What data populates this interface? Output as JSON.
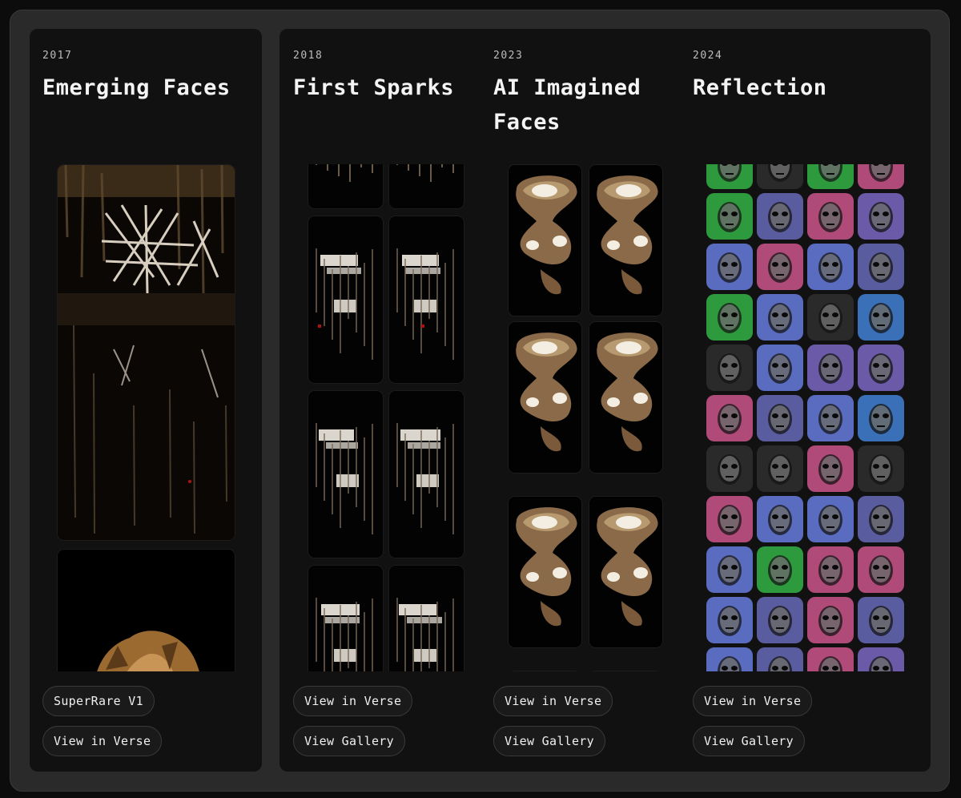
{
  "collections": [
    {
      "year": "2017",
      "title": "Emerging Faces",
      "buttons": [
        "SuperRare V1",
        "View in Verse"
      ]
    },
    {
      "year": "2018",
      "title": "First Sparks",
      "buttons": [
        "View in Verse",
        "View Gallery"
      ]
    },
    {
      "year": "2023",
      "title_lines": [
        "AI Imagined",
        "Faces"
      ],
      "buttons": [
        "View in Verse",
        "View Gallery"
      ]
    },
    {
      "year": "2024",
      "title": "Reflection",
      "buttons": [
        "View in Verse",
        "View Gallery"
      ]
    }
  ],
  "reflection_grid": {
    "columns": 4,
    "cell_colors": [
      "#2e9a3e",
      "#2a2a2a",
      "#2e9a3e",
      "#b04a78",
      "#2e9a3e",
      "#5a5ca0",
      "#b04a78",
      "#6a5aa8",
      "#5a6cc0",
      "#b04a78",
      "#5a6cc0",
      "#5a5ca0",
      "#2e9a3e",
      "#5a6cc0",
      "#2a2a2a",
      "#3a70b8",
      "#2a2a2a",
      "#5a6cc0",
      "#6a5aa8",
      "#6a5aa8",
      "#b04a78",
      "#5a5ca0",
      "#5a6cc0",
      "#3a70b8",
      "#2a2a2a",
      "#2a2a2a",
      "#b04a78",
      "#2a2a2a",
      "#b04a78",
      "#5a6cc0",
      "#5a6cc0",
      "#5a5ca0",
      "#5a6cc0",
      "#2e9a3e",
      "#b04a78",
      "#b04a78",
      "#5a6cc0",
      "#5a5ca0",
      "#b04a78",
      "#5a5ca0",
      "#5a6cc0",
      "#5a5ca0",
      "#b04a78",
      "#6a5aa8"
    ]
  }
}
